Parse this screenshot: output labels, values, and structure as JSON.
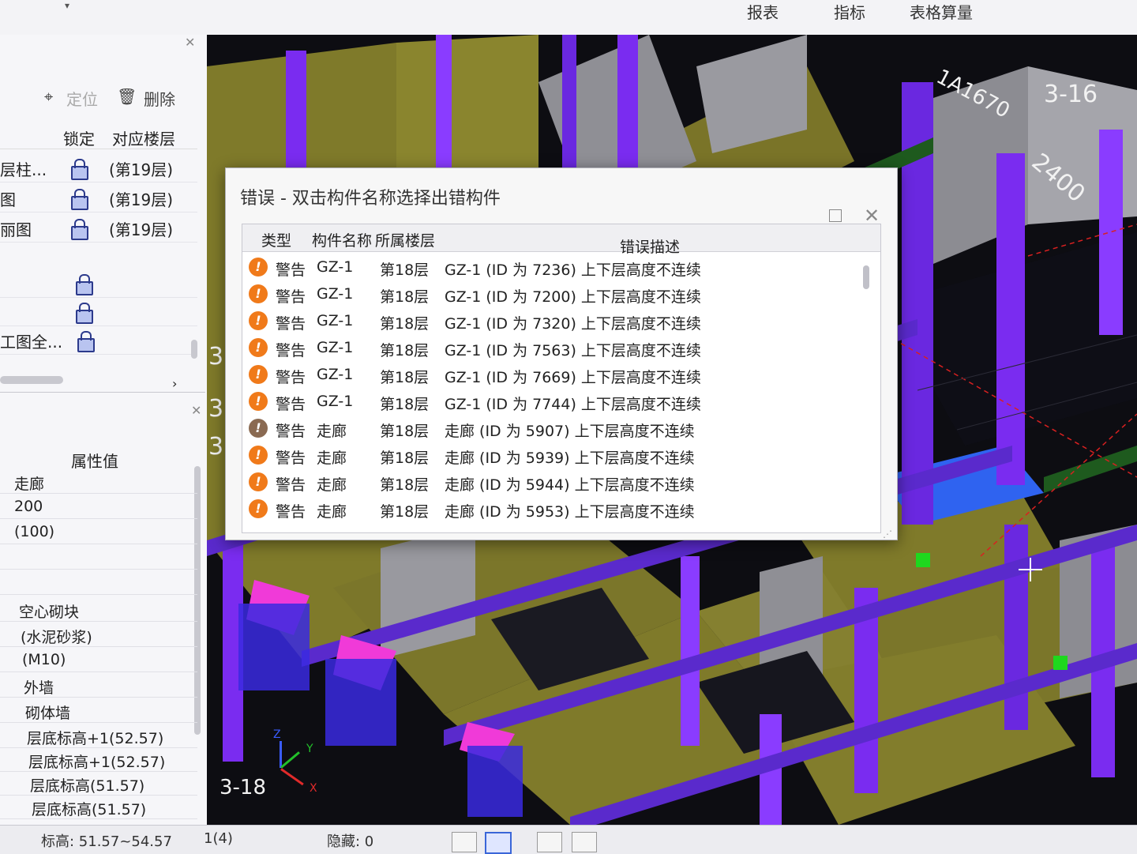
{
  "ribbon": {
    "tabs": [
      "报表",
      "指标",
      "表格算量"
    ],
    "caret": "▾"
  },
  "left_panel": {
    "toolbar": {
      "locate": "定位",
      "delete": "删除"
    },
    "columns": {
      "lock": "锁定",
      "floor": "对应楼层"
    },
    "rows": [
      {
        "name": "层柱...",
        "floor": "(第19层)"
      },
      {
        "name": "图",
        "floor": "(第19层)"
      },
      {
        "name": "丽图",
        "floor": "(第19层)"
      },
      {
        "name": "",
        "floor": ""
      },
      {
        "name": "",
        "floor": ""
      },
      {
        "name": "工图全...",
        "floor": ""
      }
    ],
    "expand_arrow": "›"
  },
  "properties": {
    "header": "属性值",
    "values": [
      "走廊",
      "200",
      "(100)",
      "",
      "",
      "空心砌块",
      "(水泥砂浆)",
      "(M10)",
      "外墙",
      "砌体墙",
      "层底标高+1(52.57)",
      "层底标高+1(52.57)",
      "层底标高(51.57)",
      "层底标高(51.57)"
    ]
  },
  "status": {
    "elevation": "标高: 51.57~54.57",
    "count": "1(4)",
    "hidden": "隐藏: 0"
  },
  "viewport": {
    "labels": [
      "3-16",
      "2400",
      "1A1670",
      "3-18",
      "3",
      "3",
      "3"
    ],
    "axes": {
      "x": "X",
      "y": "Y",
      "z": "Z"
    }
  },
  "dialog": {
    "title": "错误 - 双击构件名称选择出错构件",
    "columns": {
      "type": "类型",
      "name": "构件名称",
      "floor": "所属楼层",
      "desc": "错误描述"
    },
    "rows": [
      {
        "type": "警告",
        "name": "GZ-1",
        "floor": "第18层",
        "desc": "GZ-1 (ID 为 7236) 上下层高度不连续"
      },
      {
        "type": "警告",
        "name": "GZ-1",
        "floor": "第18层",
        "desc": "GZ-1 (ID 为 7200) 上下层高度不连续"
      },
      {
        "type": "警告",
        "name": "GZ-1",
        "floor": "第18层",
        "desc": "GZ-1 (ID 为 7320) 上下层高度不连续"
      },
      {
        "type": "警告",
        "name": "GZ-1",
        "floor": "第18层",
        "desc": "GZ-1 (ID 为 7563) 上下层高度不连续"
      },
      {
        "type": "警告",
        "name": "GZ-1",
        "floor": "第18层",
        "desc": "GZ-1 (ID 为 7669) 上下层高度不连续"
      },
      {
        "type": "警告",
        "name": "GZ-1",
        "floor": "第18层",
        "desc": "GZ-1 (ID 为 7744) 上下层高度不连续"
      },
      {
        "type": "警告",
        "name": "走廊",
        "floor": "第18层",
        "desc": "走廊 (ID 为 5907) 上下层高度不连续"
      },
      {
        "type": "警告",
        "name": "走廊",
        "floor": "第18层",
        "desc": "走廊 (ID 为 5939) 上下层高度不连续"
      },
      {
        "type": "警告",
        "name": "走廊",
        "floor": "第18层",
        "desc": "走廊 (ID 为 5944) 上下层高度不连续"
      },
      {
        "type": "警告",
        "name": "走廊",
        "floor": "第18层",
        "desc": "走廊 (ID 为 5953) 上下层高度不连续"
      }
    ]
  },
  "colors": {
    "wall_olive": "#7f7a2a",
    "column_purple": "#7a2cf0",
    "beam_violet": "#5a2acc",
    "gray_wall": "#8f8f95",
    "magenta": "#f03ad8",
    "warning_orange": "#f07a1a"
  }
}
